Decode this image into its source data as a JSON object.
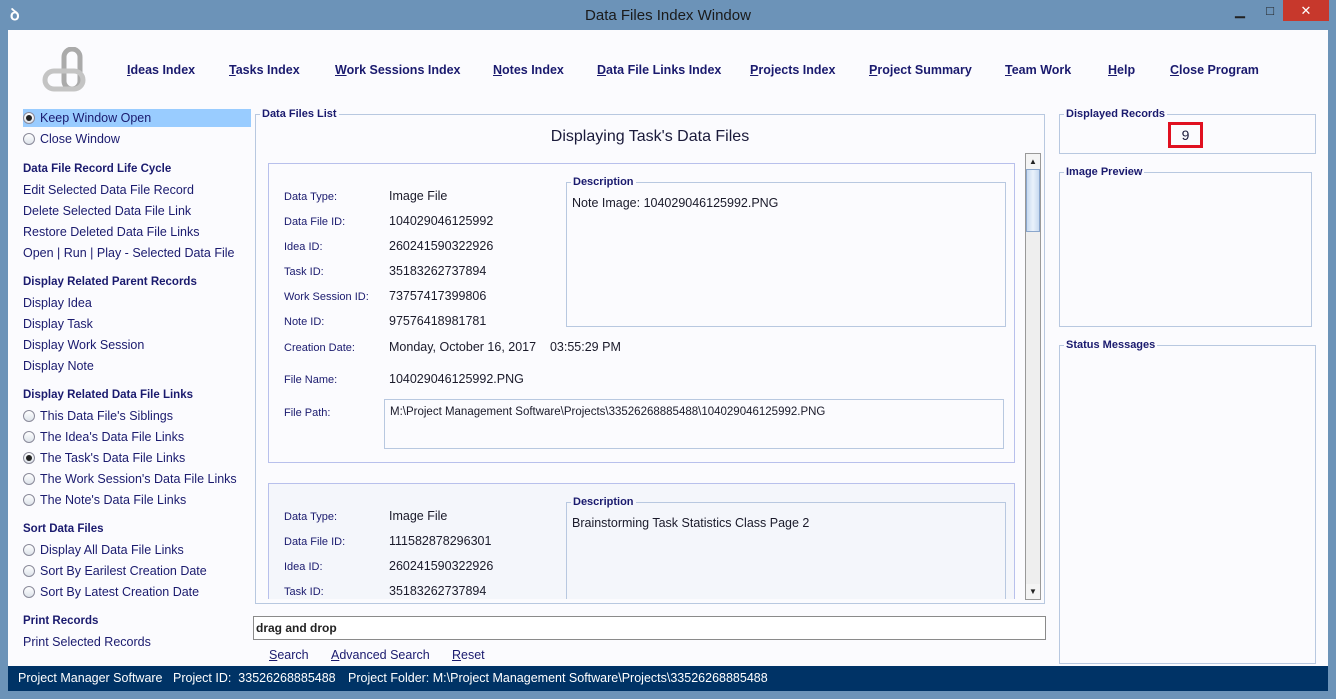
{
  "window": {
    "title": "Data Files Index Window",
    "minimize": "▁",
    "maximize": "□",
    "close": "✕"
  },
  "nav": [
    "Ideas Index",
    "Tasks Index",
    "Work Sessions Index",
    "Notes Index",
    "Data File Links Index",
    "Projects Index",
    "Project Summary",
    "Team Work",
    "Help",
    "Close Program"
  ],
  "sidebar": {
    "keep_open": "Keep Window Open",
    "close_window": "Close Window",
    "lifecycle_heading": "Data File Record Life Cycle",
    "lifecycle": [
      "Edit Selected Data File Record",
      "Delete Selected Data File Link",
      "Restore Deleted Data File Links",
      "Open | Run | Play - Selected Data File"
    ],
    "parents_heading": "Display Related Parent Records",
    "parents": [
      "Display Idea",
      "Display Task",
      "Display Work Session",
      "Display Note"
    ],
    "links_heading": "Display Related Data File Links",
    "links": [
      "This Data File's Siblings",
      "The Idea's Data File Links",
      "The Task's Data File Links",
      "The Work Session's Data File Links",
      "The Note's Data File Links"
    ],
    "links_selected": 2,
    "sort_heading": "Sort Data Files",
    "sort": [
      "Display All Data File Links",
      "Sort By Earilest Creation Date",
      "Sort By Latest Creation Date"
    ],
    "print_heading": "Print Records",
    "print": [
      "Print Selected Records"
    ]
  },
  "list": {
    "label": "Data Files List",
    "heading": "Displaying Task's Data Files",
    "labels": {
      "type": "Data Type:",
      "id": "Data File ID:",
      "idea": "Idea ID:",
      "task": "Task ID:",
      "session": "Work Session ID:",
      "note": "Note ID:",
      "created": "Creation Date:",
      "name": "File Name:",
      "path": "File Path:",
      "description": "Description"
    },
    "records": [
      {
        "type": "Image File",
        "id": "104029046125992",
        "idea": "260241590322926",
        "task": "35183262737894",
        "session": "73757417399806",
        "note": "97576418981781",
        "created": "Monday, October 16, 2017    03:55:29 PM",
        "name": "104029046125992.PNG",
        "path": "M:\\Project Management Software\\Projects\\33526268885488\\104029046125992.PNG",
        "description": "Note Image: 104029046125992.PNG"
      },
      {
        "type": "Image File",
        "id": "111582878296301",
        "idea": "260241590322926",
        "task": "35183262737894",
        "description": "Brainstorming Task Statistics Class Page 2"
      }
    ]
  },
  "search": {
    "value": "drag and drop",
    "search": "Search",
    "advanced": "Advanced Search",
    "reset": "Reset"
  },
  "right": {
    "records_label": "Displayed Records",
    "records_count": "9",
    "preview_label": "Image Preview",
    "status_label": "Status Messages"
  },
  "statusbar": {
    "app": "Project Manager Software",
    "project_id": "Project ID:  33526268885488",
    "folder": "Project Folder: M:\\Project Management Software\\Projects\\33526268885488"
  }
}
